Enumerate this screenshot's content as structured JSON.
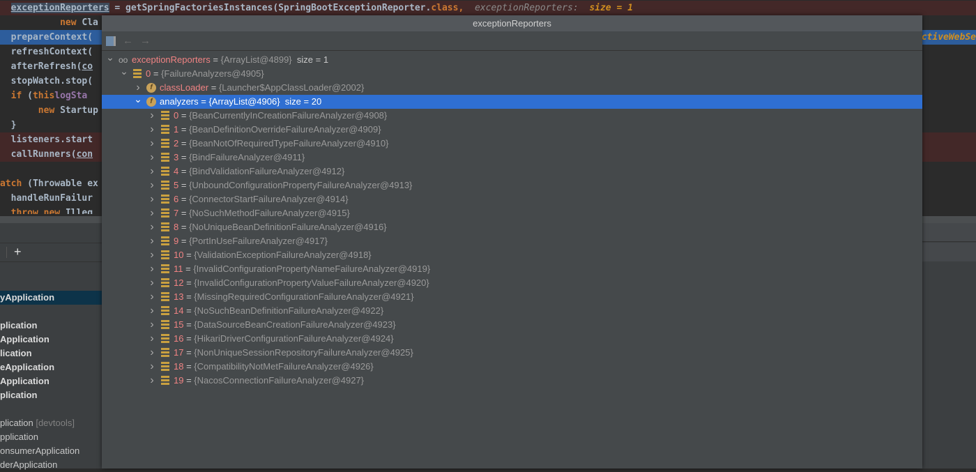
{
  "editor": {
    "line1": {
      "var": "exceptionReporters",
      "rest": " = getSpringFactoriesInstances(SpringBootExceptionReporter.",
      "kw": "class",
      "comma": ",",
      "hint_name": "exceptionReporters:",
      "hint_value": "size = 1"
    },
    "line2": {
      "kw": "new",
      "rest": " Cla"
    },
    "line3": "prepareContext(",
    "line4": "refreshContext(",
    "line5": {
      "a": "afterRefresh(",
      "b": "co"
    },
    "line6": "stopWatch.stop(",
    "line7": {
      "kw": "if",
      "a": " (",
      "b": "this",
      ".": ".",
      "c": "logSta"
    },
    "line8": {
      "kw": "new",
      "rest": " Startup"
    },
    "line9": "}",
    "line10": "listeners.start",
    "line11": {
      "a": "callRunners(",
      "b": "con"
    },
    "line13": {
      "kw": "atch",
      "rest": " (Throwable ex"
    },
    "line14": "handleRunFailur",
    "line15": {
      "kw": "throw new",
      "rest": " Illeg"
    },
    "right_hint": "ctiveWebSe"
  },
  "left_panel": {
    "toolbar_add": "+",
    "items": [
      {
        "label": "yApplication",
        "bold": true,
        "selected": true
      },
      {
        "label": "plication",
        "bold": true
      },
      {
        "label": "Application",
        "bold": true
      },
      {
        "label": "lication",
        "bold": true
      },
      {
        "label": "eApplication",
        "bold": true
      },
      {
        "label": "Application",
        "bold": true
      },
      {
        "label": "plication",
        "bold": true
      },
      {
        "label": "plication",
        "suffix": "[devtools]"
      },
      {
        "label": "pplication"
      },
      {
        "label": "onsumerApplication"
      },
      {
        "label": "derApplication"
      }
    ]
  },
  "popup": {
    "title": "exceptionReporters",
    "toolbar": {
      "back": "←",
      "forward": "→"
    },
    "colors": {
      "selection": "#2f6fd2",
      "name": "#f08383",
      "type": "#9a9a9a"
    },
    "tree": [
      {
        "level": 0,
        "icon": "watch-icon",
        "expanded": true,
        "name": "exceptionReporters",
        "type": "{ArrayList@4899}",
        "extra": "size = 1"
      },
      {
        "level": 1,
        "icon": "list-icon",
        "expanded": true,
        "name": "0",
        "type": "{FailureAnalyzers@4905}"
      },
      {
        "level": 2,
        "icon": "field-icon",
        "expanded": false,
        "name": "classLoader",
        "type": "{Launcher$AppClassLoader@2002}"
      },
      {
        "level": 2,
        "icon": "field-icon",
        "expanded": true,
        "selected": true,
        "name": "analyzers",
        "type": "{ArrayList@4906}",
        "extra": "size = 20"
      },
      {
        "level": 3,
        "icon": "list-icon",
        "name": "0",
        "type": "{BeanCurrentlyInCreationFailureAnalyzer@4908}"
      },
      {
        "level": 3,
        "icon": "list-icon",
        "name": "1",
        "type": "{BeanDefinitionOverrideFailureAnalyzer@4909}"
      },
      {
        "level": 3,
        "icon": "list-icon",
        "name": "2",
        "type": "{BeanNotOfRequiredTypeFailureAnalyzer@4910}"
      },
      {
        "level": 3,
        "icon": "list-icon",
        "name": "3",
        "type": "{BindFailureAnalyzer@4911}"
      },
      {
        "level": 3,
        "icon": "list-icon",
        "name": "4",
        "type": "{BindValidationFailureAnalyzer@4912}"
      },
      {
        "level": 3,
        "icon": "list-icon",
        "name": "5",
        "type": "{UnboundConfigurationPropertyFailureAnalyzer@4913}"
      },
      {
        "level": 3,
        "icon": "list-icon",
        "name": "6",
        "type": "{ConnectorStartFailureAnalyzer@4914}"
      },
      {
        "level": 3,
        "icon": "list-icon",
        "name": "7",
        "type": "{NoSuchMethodFailureAnalyzer@4915}"
      },
      {
        "level": 3,
        "icon": "list-icon",
        "name": "8",
        "type": "{NoUniqueBeanDefinitionFailureAnalyzer@4916}"
      },
      {
        "level": 3,
        "icon": "list-icon",
        "name": "9",
        "type": "{PortInUseFailureAnalyzer@4917}"
      },
      {
        "level": 3,
        "icon": "list-icon",
        "name": "10",
        "type": "{ValidationExceptionFailureAnalyzer@4918}"
      },
      {
        "level": 3,
        "icon": "list-icon",
        "name": "11",
        "type": "{InvalidConfigurationPropertyNameFailureAnalyzer@4919}"
      },
      {
        "level": 3,
        "icon": "list-icon",
        "name": "12",
        "type": "{InvalidConfigurationPropertyValueFailureAnalyzer@4920}"
      },
      {
        "level": 3,
        "icon": "list-icon",
        "name": "13",
        "type": "{MissingRequiredConfigurationFailureAnalyzer@4921}"
      },
      {
        "level": 3,
        "icon": "list-icon",
        "name": "14",
        "type": "{NoSuchBeanDefinitionFailureAnalyzer@4922}"
      },
      {
        "level": 3,
        "icon": "list-icon",
        "name": "15",
        "type": "{DataSourceBeanCreationFailureAnalyzer@4923}"
      },
      {
        "level": 3,
        "icon": "list-icon",
        "name": "16",
        "type": "{HikariDriverConfigurationFailureAnalyzer@4924}"
      },
      {
        "level": 3,
        "icon": "list-icon",
        "name": "17",
        "type": "{NonUniqueSessionRepositoryFailureAnalyzer@4925}"
      },
      {
        "level": 3,
        "icon": "list-icon",
        "name": "18",
        "type": "{CompatibilityNotMetFailureAnalyzer@4926}"
      },
      {
        "level": 3,
        "icon": "list-icon",
        "name": "19",
        "type": "{NacosConnectionFailureAnalyzer@4927}"
      }
    ]
  }
}
